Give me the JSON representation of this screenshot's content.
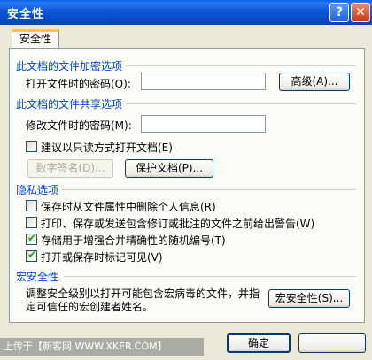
{
  "window": {
    "title": "安全性",
    "help_glyph": "?",
    "close_glyph": "✕"
  },
  "tab": {
    "label": "安全性"
  },
  "encryption": {
    "section_title": "此文档的文件加密选项",
    "open_password_label": "打开文件时的密码(O):",
    "open_password_value": "",
    "advanced_button": "高级(A)..."
  },
  "sharing": {
    "section_title": "此文档的文件共享选项",
    "modify_password_label": "修改文件时的密码(M):",
    "modify_password_value": "",
    "readonly_recommended": {
      "label": "建议以只读方式打开文档(E)",
      "checked": false
    },
    "digital_signature_button": "数字签名(D)...",
    "protect_document_button": "保护文档(P)..."
  },
  "privacy": {
    "section_title": "隐私选项",
    "options": [
      {
        "label": "保存时从文件属性中删除个人信息(R)",
        "checked": false
      },
      {
        "label": "打印、保存或发送包含修订或批注的文件之前给出警告(W)",
        "checked": false
      },
      {
        "label": "存储用于增强合并精确性的随机编号(T)",
        "checked": true
      },
      {
        "label": "打开或保存时标记可见(V)",
        "checked": true
      }
    ]
  },
  "macro": {
    "section_title": "宏安全性",
    "description_line1": "调整安全级别以打开可能包含宏病毒的文件，并指",
    "description_line2": "定可信任的宏创建者姓名。",
    "macro_security_button": "宏安全性(S)..."
  },
  "footer": {
    "ok_button": "确定",
    "cancel_button": ""
  },
  "watermark": "上传于【新客网 WWW.XKER.COM】",
  "colors": {
    "titlebar": "#0A49C6",
    "section_title": "#0046D5",
    "dialog_bg": "#ECE9D8",
    "check_mark": "#21A121"
  }
}
